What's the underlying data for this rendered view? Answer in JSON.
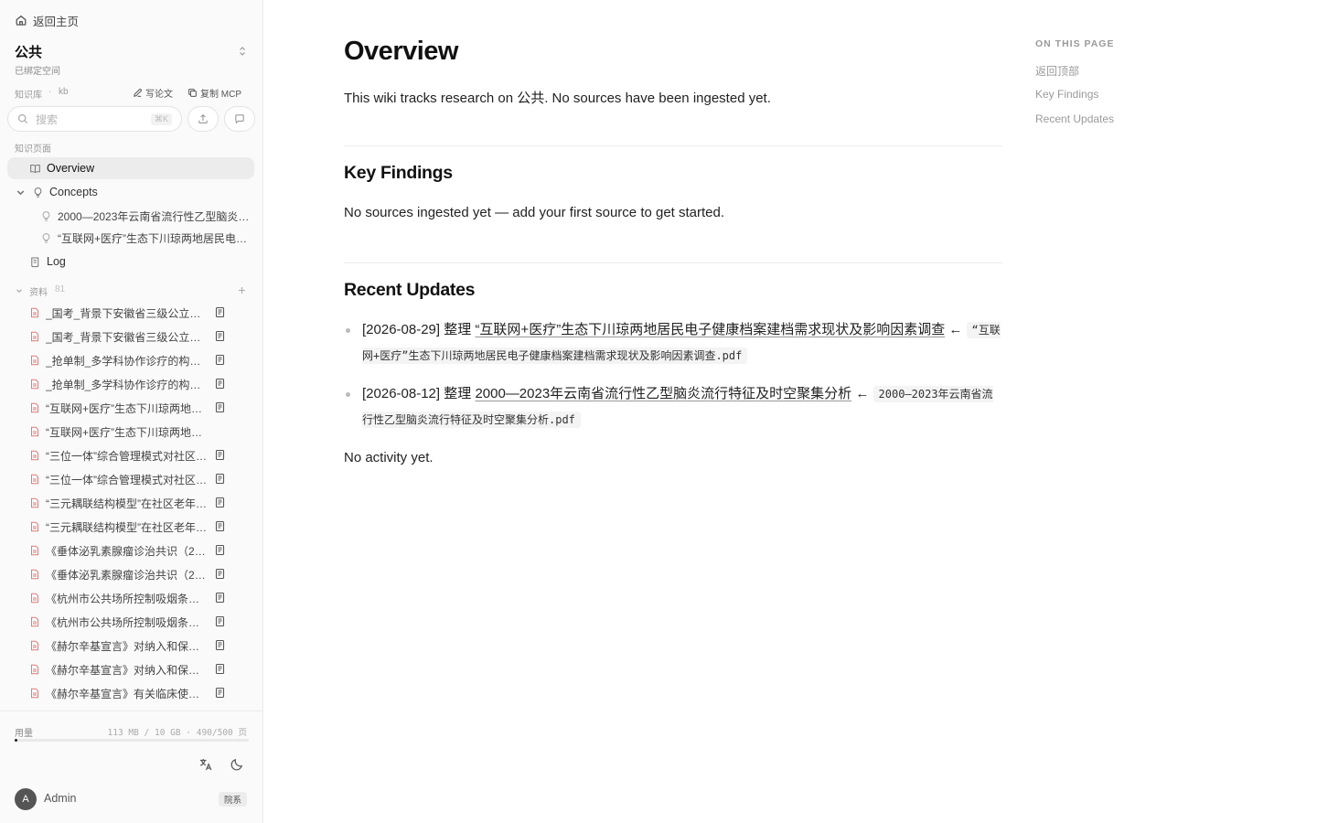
{
  "sidebar": {
    "back_home": "返回主页",
    "space": {
      "title": "公共",
      "subtitle": "已绑定空间"
    },
    "kb": {
      "label": "知识库",
      "dot": "·",
      "name": "kb",
      "write_paper": "写论文",
      "copy_mcp": "复制 MCP"
    },
    "search": {
      "placeholder": "搜索",
      "shortcut": "⌘K"
    },
    "pages_label": "知识页面",
    "pages": {
      "overview": "Overview",
      "concepts": "Concepts",
      "concept_1": "2000—2023年云南省流行性乙型脑炎流行特征及时空聚集分析",
      "concept_2": "“互联网+医疗”生态下川琼两地居民电子健康档案建档需求现状及影响因素调查",
      "log": "Log"
    },
    "resources": {
      "label": "资料",
      "count": "81",
      "items": [
        {
          "name": "_国考_背景下安徽省三级公立医院绩效考核"
        },
        {
          "name": "_国考_背景下安徽省三级公立医院绩效考核"
        },
        {
          "name": "_抢单制_多学科协作诊疗的构建与实践"
        },
        {
          "name": "_抢单制_多学科协作诊疗的构建与实践"
        },
        {
          "name": "“互联网+医疗”生态下川琼两地居民电子健康档案"
        },
        {
          "name": "“互联网+医疗”生态下川琼两地居民电子健康档案"
        },
        {
          "name": "“三位一体”综合管理模式对社区老年人"
        },
        {
          "name": "“三位一体”综合管理模式对社区老年人"
        },
        {
          "name": "“三元耦联结构模型”在社区老年人中的应用"
        },
        {
          "name": "“三元耦联结构模型”在社区老年人中的应用"
        },
        {
          "name": "《垂体泌乳素腺瘤诊治共识（2014版）》"
        },
        {
          "name": "《垂体泌乳素腺瘤诊治共识（2014版）》"
        },
        {
          "name": "《杭州市公共场所控制吸烟条例》实施效果"
        },
        {
          "name": "《杭州市公共场所控制吸烟条例》实施效果"
        },
        {
          "name": "《赫尔辛基宣言》对纳入和保护弱势群体"
        },
        {
          "name": "《赫尔辛基宣言》对纳入和保护弱势群体"
        },
        {
          "name": "《赫尔辛基宣言》有关临床使用安慰剂"
        }
      ]
    },
    "usage": {
      "label": "用量",
      "value": "113 MB / 10 GB · 490/500 页",
      "fraction": 0.011
    },
    "user": {
      "initial": "A",
      "name": "Admin",
      "role": "院系"
    }
  },
  "main": {
    "title": "Overview",
    "intro": "This wiki tracks research on 公共. No sources have been ingested yet.",
    "key_findings": {
      "heading": "Key Findings",
      "text": "No sources ingested yet — add your first source to get started."
    },
    "recent_updates": {
      "heading": "Recent Updates",
      "items": [
        {
          "date": "[2026-08-29]",
          "action": "整理",
          "link": "“互联网+医疗”生态下川琼两地居民电子健康档案建档需求现状及影响因素调查",
          "arrow": "←",
          "file": "“互联网+医疗”生态下川琼两地居民电子健康档案建档需求现状及影响因素调查.pdf"
        },
        {
          "date": "[2026-08-12]",
          "action": "整理",
          "link": "2000—2023年云南省流行性乙型脑炎流行特征及时空聚集分析",
          "arrow": "←",
          "file": "2000—2023年云南省流行性乙型脑炎流行特征及时空聚集分析.pdf"
        }
      ],
      "empty_note": "No activity yet."
    }
  },
  "toc": {
    "title": "ON THIS PAGE",
    "items": [
      "返回顶部",
      "Key Findings",
      "Recent Updates"
    ]
  }
}
